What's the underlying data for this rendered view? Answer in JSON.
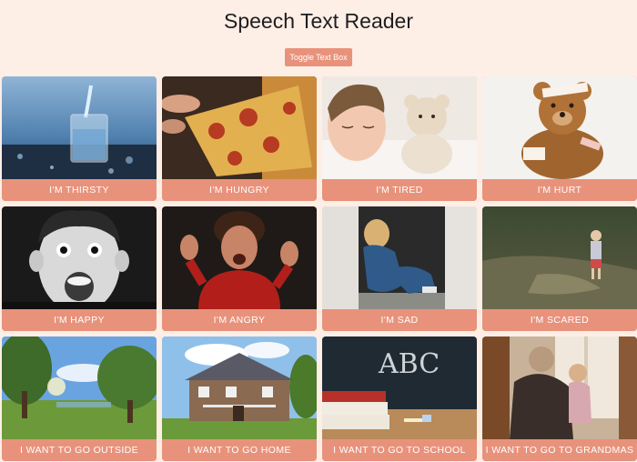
{
  "header": {
    "title": "Speech Text Reader",
    "toggle_label": "Toggle Text Box"
  },
  "colors": {
    "background": "#fdeee6",
    "accent": "#e8927b",
    "label_text": "#ffffff"
  },
  "cards": [
    {
      "label": "I'M THIRSTY",
      "image": "glass-of-water"
    },
    {
      "label": "I'M HUNGRY",
      "image": "pizza-slice"
    },
    {
      "label": "I'M TIRED",
      "image": "sleeping-child-with-teddy"
    },
    {
      "label": "I'M HURT",
      "image": "bandaged-teddy-bear"
    },
    {
      "label": "I'M HAPPY",
      "image": "excited-boy"
    },
    {
      "label": "I'M ANGRY",
      "image": "shouting-child"
    },
    {
      "label": "I'M SAD",
      "image": "child-sitting-in-doorway"
    },
    {
      "label": "I'M SCARED",
      "image": "child-alone-in-woods"
    },
    {
      "label": "I WANT TO GO OUTSIDE",
      "image": "park-with-trees"
    },
    {
      "label": "I WANT TO GO HOME",
      "image": "house"
    },
    {
      "label": "I WANT TO GO TO SCHOOL",
      "image": "chalkboard-abc"
    },
    {
      "label": "I WANT TO GO TO GRANDMAS",
      "image": "grandmother-with-child"
    }
  ]
}
